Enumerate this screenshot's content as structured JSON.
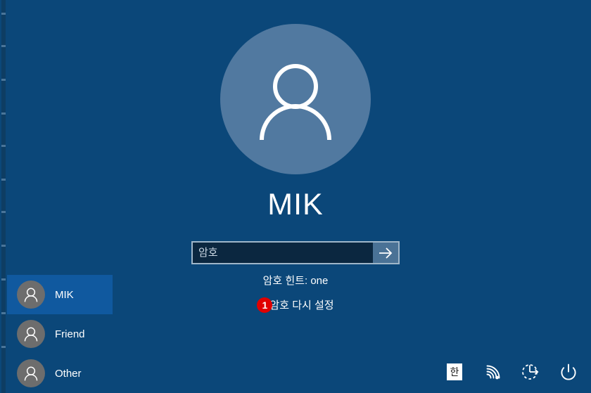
{
  "screen": {
    "background_color": "#0b4779",
    "accent_color": "#10599f"
  },
  "account": {
    "name": "MIK",
    "avatar_icon": "person-icon",
    "avatar_color": "#5179a0"
  },
  "password": {
    "placeholder": "암호",
    "value": "",
    "submit_icon": "arrow-right-icon",
    "hint": "암호 힌트: one",
    "reset_label": "암호 다시 설정",
    "reset_badge": "1",
    "badge_color": "#e00000"
  },
  "user_list": {
    "items": [
      {
        "label": "MIK",
        "selected": true,
        "avatar_icon": "person-icon"
      },
      {
        "label": "Friend",
        "selected": false,
        "avatar_icon": "person-icon"
      },
      {
        "label": "Other",
        "selected": false,
        "avatar_icon": "person-icon"
      }
    ]
  },
  "tray": {
    "ime_label": "한",
    "items": [
      {
        "icon": "ime-indicator"
      },
      {
        "icon": "wifi-icon"
      },
      {
        "icon": "ease-of-access-icon"
      },
      {
        "icon": "power-icon"
      }
    ]
  }
}
